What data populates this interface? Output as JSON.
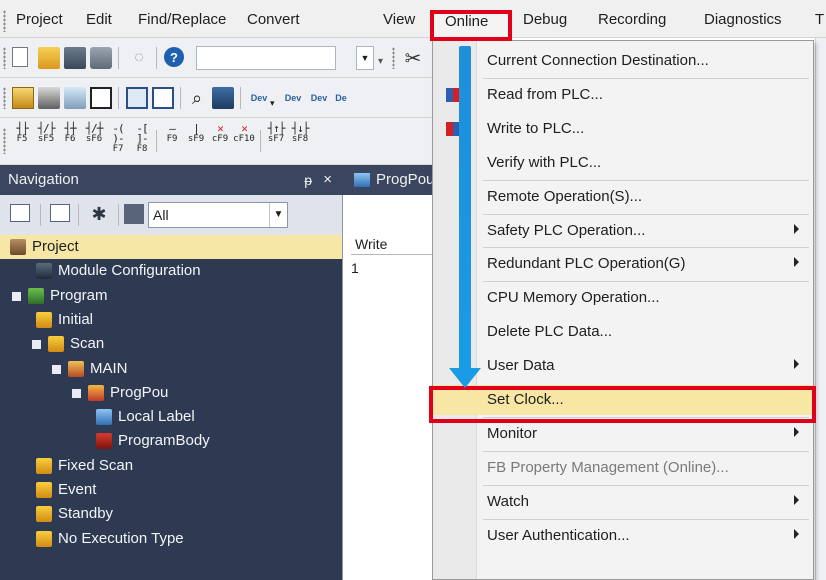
{
  "menubar": {
    "items": [
      "Project",
      "Edit",
      "Find/Replace",
      "Convert",
      "View",
      "Online",
      "Debug",
      "Recording",
      "Diagnostics",
      "T"
    ],
    "highlighted": "Online"
  },
  "toolbar": {
    "combo_value": "",
    "fkeys": [
      {
        "sym": "┤├",
        "label": "F5"
      },
      {
        "sym": "┤/├",
        "label": "sF5"
      },
      {
        "sym": "┤┼",
        "label": "F6"
      },
      {
        "sym": "┤/┼",
        "label": "sF6"
      },
      {
        "sym": "-( )-",
        "label": "F7"
      },
      {
        "sym": "-[ ]-",
        "label": "F8"
      },
      {
        "sym": "—",
        "label": "F9"
      },
      {
        "sym": "|",
        "label": "sF9"
      },
      {
        "sym": "✕",
        "label": "cF9"
      },
      {
        "sym": "✕",
        "label": "cF10"
      },
      {
        "sym": "┤↑├",
        "label": "sF7"
      },
      {
        "sym": "┤↓├",
        "label": "sF8"
      }
    ]
  },
  "navigation": {
    "title": "Navigation",
    "pin_glyph": "ᵽ",
    "close_glyph": "×",
    "filter_value": "All",
    "tree": [
      {
        "label": "Project",
        "indent": 0,
        "icon": "project-icon",
        "expander": "",
        "selected": true
      },
      {
        "label": "Module Configuration",
        "indent": 1,
        "icon": "module-configuration-icon",
        "expander": "",
        "selected": false
      },
      {
        "label": "Program",
        "indent": 0,
        "icon": "program-icon",
        "expander": "minus",
        "selected": false
      },
      {
        "label": "Initial",
        "indent": 1,
        "icon": "folder-icon",
        "expander": "",
        "selected": false
      },
      {
        "label": "Scan",
        "indent": 1,
        "icon": "folder-icon",
        "expander": "minus",
        "selected": false
      },
      {
        "label": "MAIN",
        "indent": 2,
        "icon": "main-program-icon",
        "expander": "minus",
        "selected": false
      },
      {
        "label": "ProgPou",
        "indent": 3,
        "icon": "pou-icon",
        "expander": "minus",
        "selected": false
      },
      {
        "label": "Local Label",
        "indent": 4,
        "icon": "local-label-icon",
        "expander": "",
        "selected": false
      },
      {
        "label": "ProgramBody",
        "indent": 4,
        "icon": "program-body-icon",
        "expander": "",
        "selected": false
      },
      {
        "label": "Fixed Scan",
        "indent": 1,
        "icon": "folder-icon",
        "expander": "",
        "selected": false
      },
      {
        "label": "Event",
        "indent": 1,
        "icon": "folder-icon",
        "expander": "",
        "selected": false
      },
      {
        "label": "Standby",
        "indent": 1,
        "icon": "folder-icon",
        "expander": "",
        "selected": false
      },
      {
        "label": "No Execution Type",
        "indent": 1,
        "icon": "folder-icon",
        "expander": "",
        "selected": false
      }
    ]
  },
  "editor": {
    "tab_label": "ProgPou",
    "column_header": "Write",
    "row_number": "1"
  },
  "online_menu": {
    "items": [
      {
        "label": "Current Connection Destination...",
        "submenu": false,
        "icon": "",
        "disabled": false,
        "separator_before": false
      },
      {
        "label": "Read from PLC...",
        "submenu": false,
        "icon": "read-from-plc-icon",
        "disabled": false,
        "separator_before": true
      },
      {
        "label": "Write to PLC...",
        "submenu": false,
        "icon": "write-to-plc-icon",
        "disabled": false,
        "separator_before": false
      },
      {
        "label": "Verify with PLC...",
        "submenu": false,
        "icon": "",
        "disabled": false,
        "separator_before": false
      },
      {
        "label": "Remote Operation(S)...",
        "submenu": false,
        "icon": "",
        "disabled": false,
        "separator_before": true
      },
      {
        "label": "Safety PLC Operation...",
        "submenu": true,
        "icon": "",
        "disabled": false,
        "separator_before": true
      },
      {
        "label": "Redundant PLC Operation(G)",
        "submenu": true,
        "icon": "",
        "disabled": false,
        "separator_before": true
      },
      {
        "label": "CPU Memory Operation...",
        "submenu": false,
        "icon": "",
        "disabled": false,
        "separator_before": true
      },
      {
        "label": "Delete PLC Data...",
        "submenu": false,
        "icon": "",
        "disabled": false,
        "separator_before": false
      },
      {
        "label": "User Data",
        "submenu": true,
        "icon": "",
        "disabled": false,
        "separator_before": false
      },
      {
        "label": "Set Clock...",
        "submenu": false,
        "icon": "",
        "disabled": false,
        "separator_before": false,
        "highlighted": true
      },
      {
        "label": "Monitor",
        "submenu": true,
        "icon": "",
        "disabled": false,
        "separator_before": true
      },
      {
        "label": "FB Property Management (Online)...",
        "submenu": false,
        "icon": "",
        "disabled": true,
        "separator_before": true
      },
      {
        "label": "Watch",
        "submenu": true,
        "icon": "",
        "disabled": false,
        "separator_before": true
      },
      {
        "label": "User Authentication...",
        "submenu": true,
        "icon": "",
        "disabled": false,
        "separator_before": true
      }
    ]
  },
  "annotation": {
    "highlight_color": "#e0001a",
    "arrow_color": "#1a9be6"
  }
}
